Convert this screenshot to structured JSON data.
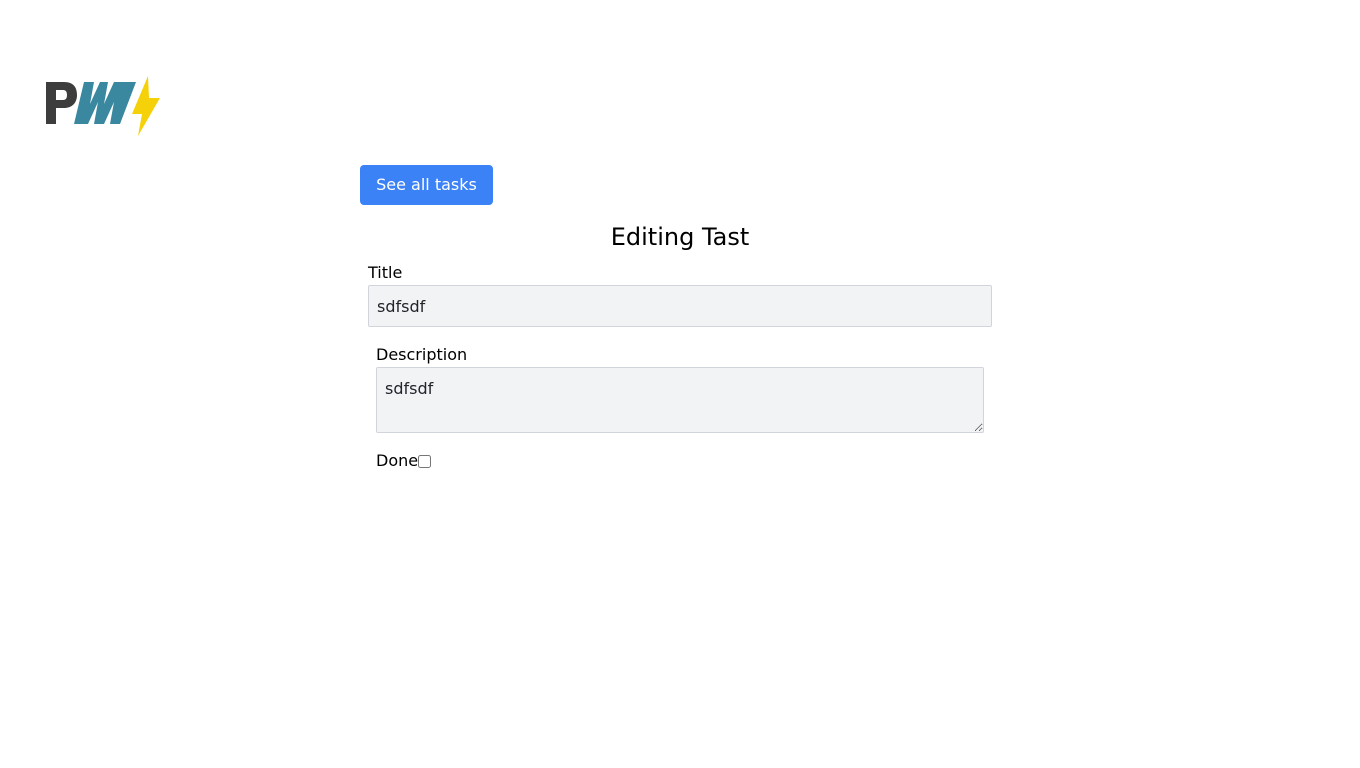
{
  "logo": {
    "icon": "pwa-logo-icon",
    "text": "PWA",
    "colors": {
      "p": "#3d3d3d",
      "w": "#3a87a0",
      "bolt": "#f5d10a"
    }
  },
  "nav": {
    "back_label": "See all tasks",
    "accent": "#3b82f6"
  },
  "page": {
    "title": "Editing Tast"
  },
  "form": {
    "title_label": "Title",
    "title_value": "sdfsdf",
    "description_label": "Description",
    "description_value": "sdfsdf",
    "done_label": "Done",
    "done_checked": false
  }
}
